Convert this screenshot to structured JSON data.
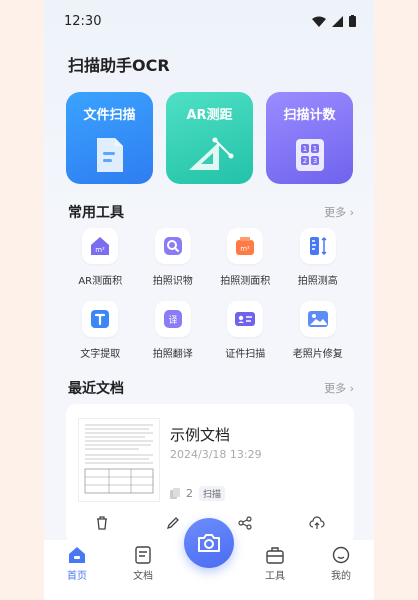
{
  "status": {
    "time": "12:30"
  },
  "app": {
    "title": "扫描助手OCR"
  },
  "features": [
    {
      "label": "文件扫描",
      "icon": "document-icon"
    },
    {
      "label": "AR测距",
      "icon": "ruler-triangle-icon"
    },
    {
      "label": "扫描计数",
      "icon": "number-grid-icon"
    }
  ],
  "tools_section": {
    "title": "常用工具",
    "more": "更多 ›"
  },
  "tools": [
    {
      "label": "AR测面积",
      "icon": "area-home-icon"
    },
    {
      "label": "拍照识物",
      "icon": "object-search-icon"
    },
    {
      "label": "拍照测面积",
      "icon": "area-measure-icon"
    },
    {
      "label": "拍照测高",
      "icon": "height-measure-icon"
    },
    {
      "label": "文字提取",
      "icon": "text-extract-icon"
    },
    {
      "label": "拍照翻译",
      "icon": "translate-icon"
    },
    {
      "label": "证件扫描",
      "icon": "id-card-icon"
    },
    {
      "label": "老照片修复",
      "icon": "photo-restore-icon"
    }
  ],
  "docs_section": {
    "title": "最近文档",
    "more": "更多 ›"
  },
  "recent_doc": {
    "name": "示例文档",
    "date": "2024/3/18 13:29",
    "pages": "2",
    "tag": "扫描"
  },
  "tabs": [
    {
      "label": "首页",
      "icon": "home-icon",
      "active": true
    },
    {
      "label": "文档",
      "icon": "document-tab-icon",
      "active": false
    },
    {
      "label": "工具",
      "icon": "toolbox-icon",
      "active": false
    },
    {
      "label": "我的",
      "icon": "profile-icon",
      "active": false
    }
  ],
  "colors": {
    "accent": "#4a78f5",
    "blue": "#2f7df0",
    "green": "#22c2a9",
    "purple": "#6f63ee"
  }
}
